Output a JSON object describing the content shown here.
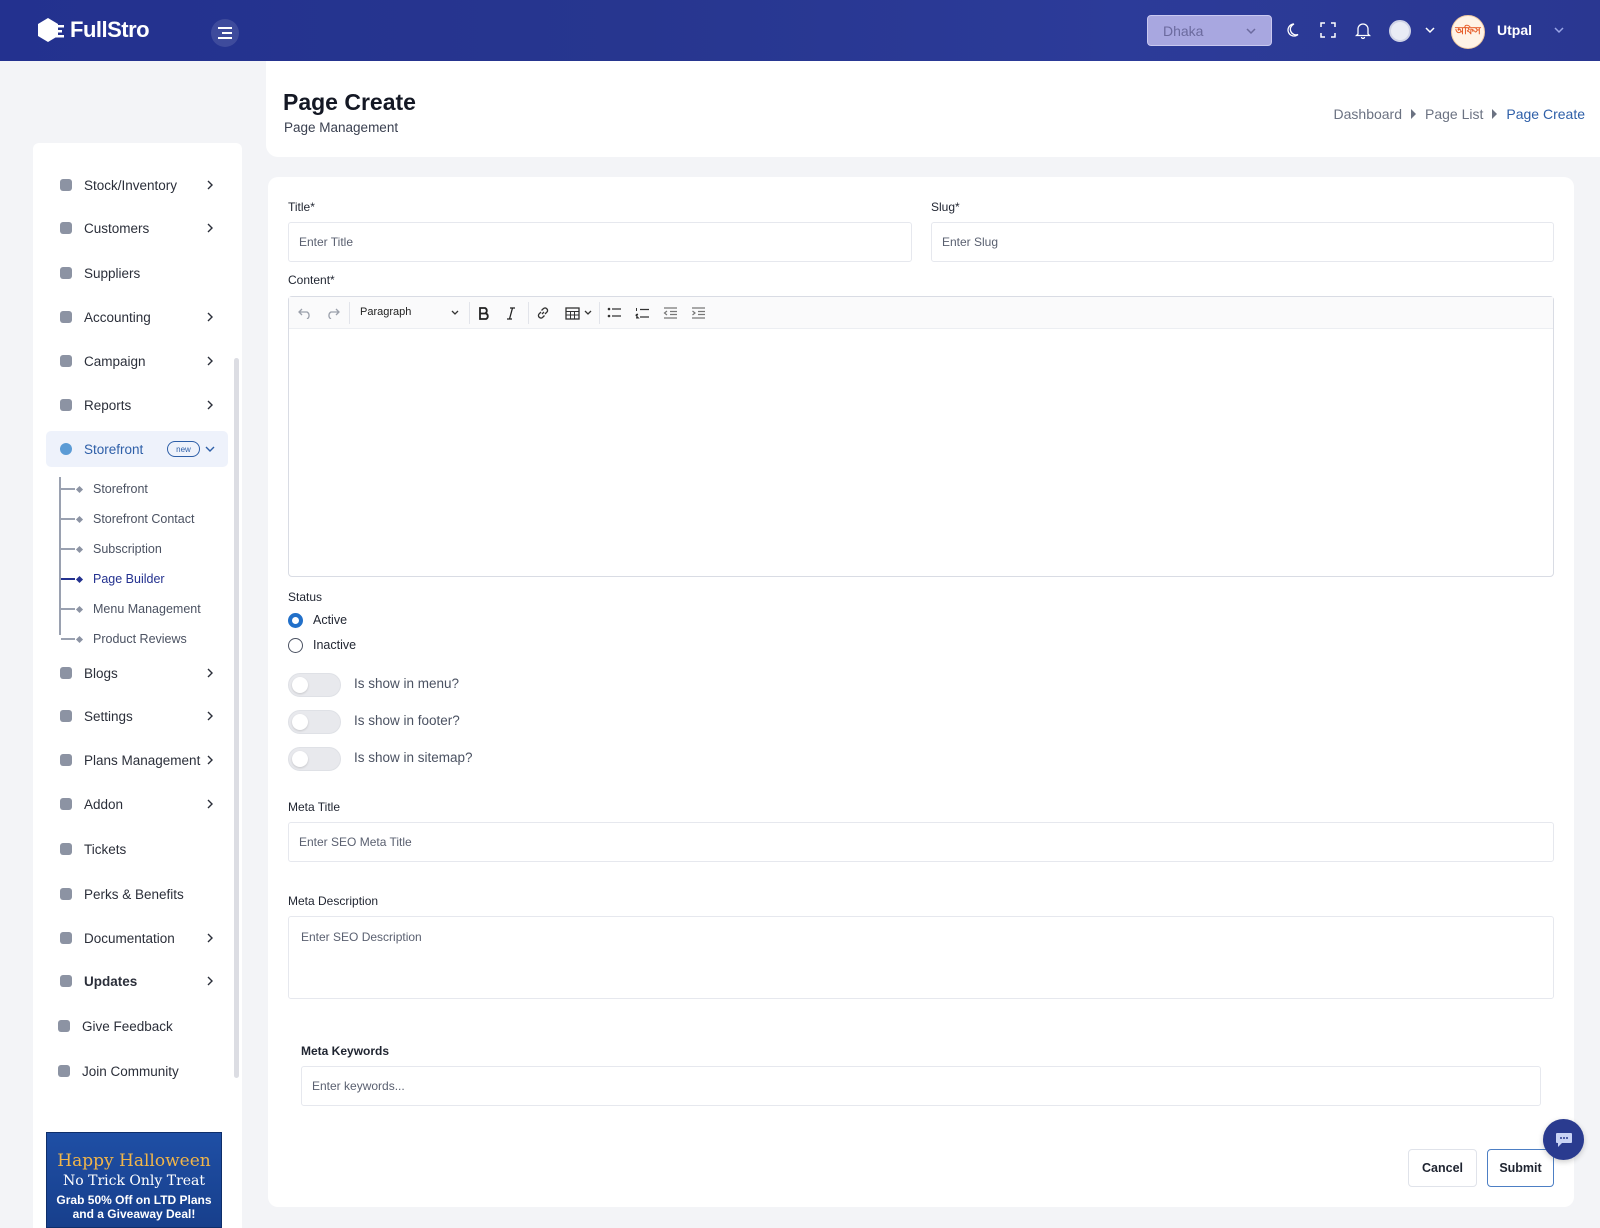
{
  "header": {
    "logo_text": "FullStro",
    "branch_select": "Dhaka",
    "user_name": "Utpal",
    "user_avatar_text": "অফিস"
  },
  "sidebar": {
    "items": [
      {
        "label": "Stock/Inventory",
        "has_arrow": true
      },
      {
        "label": "Customers",
        "has_arrow": true
      },
      {
        "label": "Suppliers",
        "has_arrow": false
      },
      {
        "label": "Accounting",
        "has_arrow": true
      },
      {
        "label": "Campaign",
        "has_arrow": true
      },
      {
        "label": "Reports",
        "has_arrow": true
      },
      {
        "label": "Storefront",
        "badge": "new",
        "active": true
      },
      {
        "label": "Blogs",
        "has_arrow": true
      },
      {
        "label": "Settings",
        "has_arrow": true
      },
      {
        "label": "Plans Management",
        "has_arrow": true
      },
      {
        "label": "Addon",
        "has_arrow": true
      },
      {
        "label": "Tickets",
        "has_arrow": false
      },
      {
        "label": "Perks & Benefits",
        "has_arrow": false
      },
      {
        "label": "Documentation",
        "has_arrow": true
      },
      {
        "label": "Updates",
        "has_arrow": true
      },
      {
        "label": "Give Feedback",
        "has_arrow": false
      },
      {
        "label": "Join Community",
        "has_arrow": false
      }
    ],
    "storefront_sub": [
      "Storefront",
      "Storefront Contact",
      "Subscription",
      "Page Builder",
      "Menu Management",
      "Product Reviews"
    ],
    "promo": {
      "line1": "Happy Halloween",
      "line2": "No Trick Only Treat",
      "line3": "Grab 50% Off on LTD Plans",
      "line4": "and a Giveaway Deal!"
    }
  },
  "page": {
    "title": "Page Create",
    "subtitle": "Page Management",
    "breadcrumb": [
      "Dashboard",
      "Page List",
      "Page Create"
    ]
  },
  "form": {
    "title_label": "Title*",
    "title_placeholder": "Enter Title",
    "slug_label": "Slug*",
    "slug_placeholder": "Enter Slug",
    "content_label": "Content*",
    "editor_format": "Paragraph",
    "status_label": "Status",
    "status_options": [
      "Active",
      "Inactive"
    ],
    "status_selected": "Active",
    "toggles": [
      {
        "label": "Is show in menu?",
        "on": false
      },
      {
        "label": "Is show in footer?",
        "on": false
      },
      {
        "label": "Is show in sitemap?",
        "on": false
      }
    ],
    "meta_title_label": "Meta Title",
    "meta_title_placeholder": "Enter SEO Meta Title",
    "meta_desc_label": "Meta Description",
    "meta_desc_placeholder": "Enter SEO Description",
    "meta_keywords_label": "Meta Keywords",
    "meta_keywords_placeholder": "Enter keywords...",
    "cancel_label": "Cancel",
    "submit_label": "Submit"
  },
  "colors": {
    "topbar": "#23318f",
    "accent": "#2e5fa8",
    "radio_active": "#2270c9"
  }
}
